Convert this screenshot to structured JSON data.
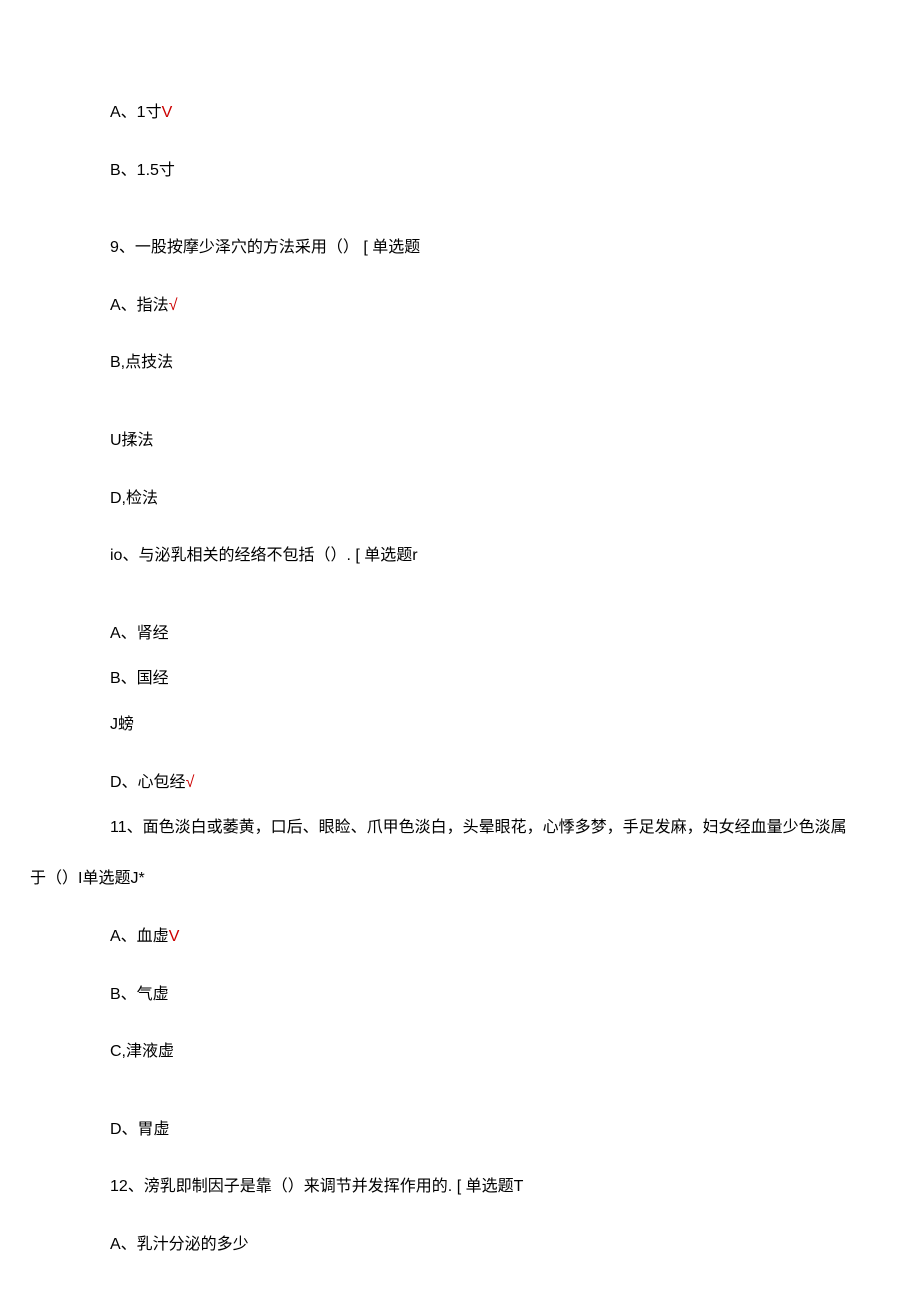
{
  "line1_a": "A、1寸",
  "line1_b": "V",
  "line2": "B、1.5寸",
  "q9": "9、一股按摩少泽穴的方法采用（） [ 单选题",
  "q9_a_a": "A、指法",
  "q9_a_b": "√",
  "q9_b": "B,点技法",
  "q9_c": "U揉法",
  "q9_d": "D,检法",
  "q10": "io、与泌乳相关的经络不包括（）. [ 单选题r",
  "q10_a": "A、肾经",
  "q10_b": "B、国经",
  "q10_c": "J螃",
  "q10_d_a": "D、心包经",
  "q10_d_b": "√",
  "q11_part1": "11、面色淡白或萎黄，口后、眼睑、爪甲色淡白，头晕眼花，心悸多梦，手足发麻，妇女经血量少色淡属",
  "q11_part2": "于（）I单选题J*",
  "q11_a_a": "A、血虚",
  "q11_a_b": "V",
  "q11_b": "B、气虚",
  "q11_c": "C,津液虚",
  "q11_d": "D、胃虚",
  "q12": "12、滂乳即制因子是靠（）来调节并发挥作用的. [ 单选题T",
  "q12_a": "A、乳汁分泌的多少"
}
